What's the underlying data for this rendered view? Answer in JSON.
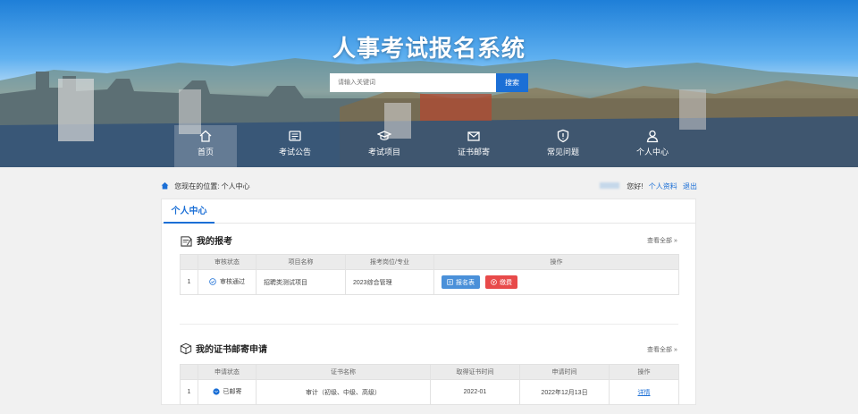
{
  "header": {
    "site_title": "人事考试报名系统",
    "search_placeholder": "请输入关键词",
    "search_button": "搜索"
  },
  "nav": [
    {
      "label": "首页",
      "icon": "home-icon",
      "active": true
    },
    {
      "label": "考试公告",
      "icon": "announcement-icon"
    },
    {
      "label": "考试项目",
      "icon": "graduation-cap-icon"
    },
    {
      "label": "证书邮寄",
      "icon": "mail-icon"
    },
    {
      "label": "常见问题",
      "icon": "shield-info-icon"
    },
    {
      "label": "个人中心",
      "icon": "user-icon"
    }
  ],
  "breadcrumb": {
    "text": "您现在的位置: 个人中心"
  },
  "userbar": {
    "greeting": "您好!",
    "profile_link": "个人资料",
    "logout_link": "退出"
  },
  "panel": {
    "tab_label": "个人中心",
    "my_exams": {
      "title": "我的报考",
      "see_all": "查看全部 »",
      "columns": [
        "",
        "审核状态",
        "项目名称",
        "报考岗位/专业",
        "操作"
      ],
      "rows": [
        {
          "index": "1",
          "status": "审核通过",
          "project": "招聘类测试项目",
          "position": "2023综合管理",
          "btn_form": "报名表",
          "btn_pay": "缴费"
        }
      ]
    },
    "certificate_mail": {
      "title": "我的证书邮寄申请",
      "see_all": "查看全部 »",
      "columns": [
        "",
        "申请状态",
        "证书名称",
        "取得证书时间",
        "申请时间",
        "操作"
      ],
      "rows": [
        {
          "index": "1",
          "status": "已邮寄",
          "cert_name": "审计（初级、中级、高级）",
          "obtained": "2022-01",
          "applied": "2022年12月13日",
          "action": "详情"
        }
      ]
    }
  },
  "colors": {
    "primary": "#1b6fd6",
    "pay_red": "#e84a4a",
    "form_blue": "#4a90d9"
  }
}
